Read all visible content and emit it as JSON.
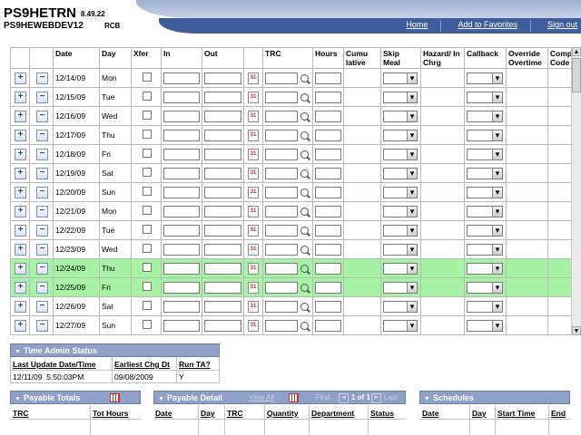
{
  "header": {
    "app_title": "PS9HETRN",
    "version": "8.49.22",
    "database": "PS9HEWEBDEV12",
    "user": "RCB",
    "links": [
      "Home",
      "Add to Favorites",
      "Sign out"
    ]
  },
  "grid": {
    "columns": [
      "",
      "",
      "Date",
      "Day",
      "Xfer",
      "In",
      "Out",
      "",
      "TRC",
      "Hours",
      "Cumu lative",
      "Skip Meal",
      "Hazard/ In Chrg",
      "Callback",
      "Override Overtime",
      "Comp Code"
    ],
    "rows": [
      {
        "date": "12/14/09",
        "day": "Mon",
        "highlight": false
      },
      {
        "date": "12/15/09",
        "day": "Tue",
        "highlight": false
      },
      {
        "date": "12/16/09",
        "day": "Wed",
        "highlight": false
      },
      {
        "date": "12/17/09",
        "day": "Thu",
        "highlight": false
      },
      {
        "date": "12/18/09",
        "day": "Fri",
        "highlight": false
      },
      {
        "date": "12/19/09",
        "day": "Sat",
        "highlight": false
      },
      {
        "date": "12/20/09",
        "day": "Sun",
        "highlight": false
      },
      {
        "date": "12/21/09",
        "day": "Mon",
        "highlight": false
      },
      {
        "date": "12/22/09",
        "day": "Tue",
        "highlight": false
      },
      {
        "date": "12/23/09",
        "day": "Wed",
        "highlight": false
      },
      {
        "date": "12/24/09",
        "day": "Thu",
        "highlight": true
      },
      {
        "date": "12/25/09",
        "day": "Fri",
        "highlight": true
      },
      {
        "date": "12/26/09",
        "day": "Sat",
        "highlight": false
      },
      {
        "date": "12/27/09",
        "day": "Sun",
        "highlight": false
      }
    ],
    "highlight_color": "#a6f3a6"
  },
  "time_admin": {
    "title": "Time Admin Status",
    "columns": [
      "Last Update Date/Time",
      "Earliest Chg Dt",
      "Run TA?"
    ],
    "values": [
      "12/11/09  5:50:03PM",
      "09/08/2009",
      "Y"
    ]
  },
  "payable_totals": {
    "title": "Payable Totals",
    "columns": [
      "TRC",
      "Tot Hours"
    ]
  },
  "payable_detail": {
    "title": "Payable Detail",
    "view_all": "View All",
    "first": "First",
    "range": "1 of 1",
    "last": "Last",
    "columns": [
      "Date",
      "Day",
      "TRC",
      "Quantity",
      "Department",
      "Status"
    ]
  },
  "schedules": {
    "title": "Schedules",
    "columns": [
      "Date",
      "Day",
      "Start Time",
      "End"
    ]
  },
  "colors": {
    "header_bar": "#3f5d9a",
    "panel_header": "#8ea0c8"
  }
}
